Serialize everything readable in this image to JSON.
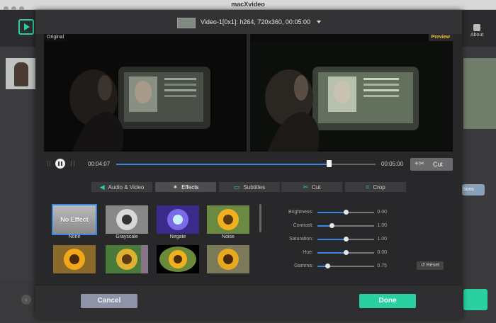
{
  "app": {
    "title": "macXvideo",
    "about_label": "About"
  },
  "background": {
    "options_label": "tions"
  },
  "video": {
    "title": "Video-1[0x1]: h264, 720x360, 00:05:00"
  },
  "preview": {
    "original_label": "Original",
    "preview_label": "Preview"
  },
  "transport": {
    "current_time": "00:04:07",
    "end_time": "00:05:00",
    "cut_label": "Cut",
    "progress": 0.82
  },
  "tabs": [
    {
      "label": "Audio & Video",
      "icon": "speaker-icon"
    },
    {
      "label": "Effects",
      "icon": "magic-wand-icon",
      "active": true
    },
    {
      "label": "Subtitles",
      "icon": "subtitle-icon"
    },
    {
      "label": "Cut",
      "icon": "scissors-icon"
    },
    {
      "label": "Crop",
      "icon": "crop-icon"
    }
  ],
  "effects": {
    "no_effect_text": "No Effect",
    "items": [
      {
        "label": "None",
        "selected": true
      },
      {
        "label": "Grayscale"
      },
      {
        "label": "Negate"
      },
      {
        "label": "Noise"
      }
    ]
  },
  "adjustments": [
    {
      "label": "Brightness:",
      "value": "0.00",
      "level": 0.5
    },
    {
      "label": "Contrast:",
      "value": "1.00",
      "level": 0.25
    },
    {
      "label": "Saturation:",
      "value": "1.00",
      "level": 0.5
    },
    {
      "label": "Hue:",
      "value": "0.00",
      "level": 0.5
    },
    {
      "label": "Gamma:",
      "value": "0.75",
      "level": 0.18
    }
  ],
  "reset_label": "Reset",
  "footer": {
    "cancel_label": "Cancel",
    "done_label": "Done"
  },
  "colors": {
    "accent": "#2ad0a0",
    "progress": "#3d86e0",
    "preview_tag": "#f0c040"
  }
}
